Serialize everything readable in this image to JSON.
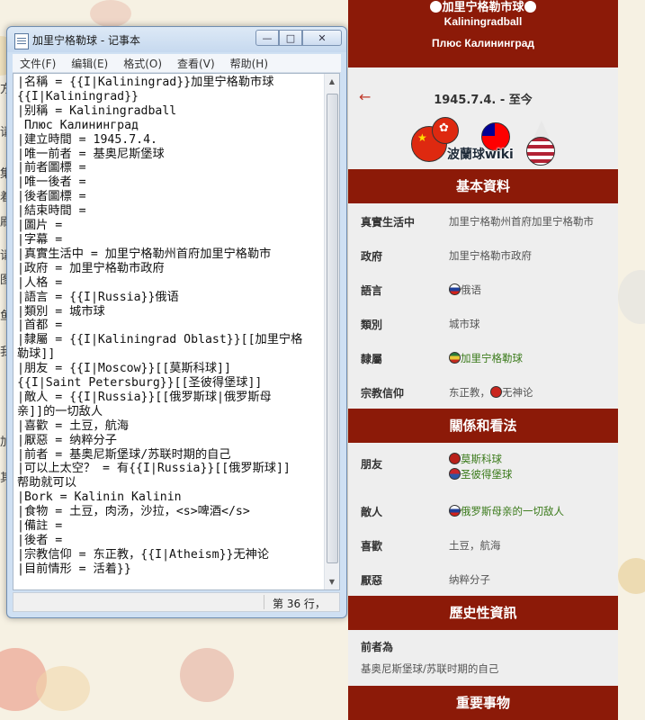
{
  "edge_chars": [
    "方",
    "",
    "请",
    "集",
    "着",
    "刷",
    "请",
    "图",
    "鱼",
    "我",
    "加",
    "其"
  ],
  "notepad": {
    "title": "加里宁格勒球 - 记事本",
    "buttons": {
      "minimize": "—",
      "maximize": "□",
      "close": "✕"
    },
    "menus": [
      "文件(F)",
      "编辑(E)",
      "格式(O)",
      "查看(V)",
      "帮助(H)"
    ],
    "content": "|名稱 = {{I|Kaliningrad}}加里宁格勒市球\n{{I|Kaliningrad}}\n|别稱 = Kaliningradball\n Плюс Калининград\n|建立時間 = 1945.7.4.\n|唯一前者 = 基奥尼斯堡球\n|前者圖標 =\n|唯一後者 =\n|後者圖標 =\n|結束時間 =\n|圖片 =\n|字幕 =\n|真實生活中 = 加里宁格勒州首府加里宁格勒市\n|政府 = 加里宁格勒市政府\n|人格 =\n|語言 = {{I|Russia}}俄语\n|類別 = 城市球\n|首都 =\n|隸屬 = {{I|Kaliningrad Oblast}}[[加里宁格\n勒球]]\n|朋友 = {{I|Moscow}}[[莫斯科球]]\n{{I|Saint Petersburg}}[[圣彼得堡球]]\n|敵人 = {{I|Russia}}[[俄罗斯球|俄罗斯母\n亲]]的一切敌人\n|喜歡 = 土豆，航海\n|厭惡 = 纳粹分子\n|前者 = 基奥尼斯堡球/苏联时期的自己\n|可以上太空？ = 有{{I|Russia}}[[俄罗斯球]]\n帮助就可以\n|Bork = Kalinin Kalinin\n|食物 = 土豆，肉汤，沙拉，<s>啤酒</s>\n|備註 =\n|後者 =\n|宗教信仰 = 东正教，{{I|Atheism}}无神论\n|目前情形 = 活着}}",
    "status": "第 36 行，"
  },
  "infobox": {
    "name": "加里宁格勒市球",
    "latin_name": "Kaliningradball",
    "alt_name": "Плюс Калининград",
    "back_arrow": "←",
    "date": "1945.7.4. - 至今",
    "logo_text": "波蘭球wiki",
    "sections": {
      "basic": "基本資料",
      "relations": "關係和看法",
      "history": "歷史性資訊",
      "events": "重要事物"
    },
    "rows": {
      "real_life": {
        "label": "真實生活中",
        "value": "加里宁格勒州首府加里宁格勒市"
      },
      "government": {
        "label": "政府",
        "value": "加里宁格勒市政府"
      },
      "language": {
        "label": "語言",
        "value": "俄语"
      },
      "type": {
        "label": "類別",
        "value": "城市球"
      },
      "affiliation": {
        "label": "隸屬",
        "value": "加里宁格勒球"
      },
      "religion": {
        "label": "宗教信仰",
        "value_a": "东正教，",
        "value_b": "无神论"
      },
      "friends": {
        "label": "朋友",
        "value_a": "莫斯科球",
        "value_b": "圣彼得堡球"
      },
      "enemies": {
        "label": "敵人",
        "value": "俄罗斯母亲的一切敌人"
      },
      "likes": {
        "label": "喜歡",
        "value": "土豆，航海"
      },
      "dislikes": {
        "label": "厭惡",
        "value": "纳粹分子"
      },
      "predecessor": {
        "label": "前者為",
        "value": "基奥尼斯堡球/苏联时期的自己"
      }
    },
    "colors": {
      "header": "#8c1a08",
      "link": "#3a7a1a",
      "back_arrow": "#c0392b"
    }
  }
}
